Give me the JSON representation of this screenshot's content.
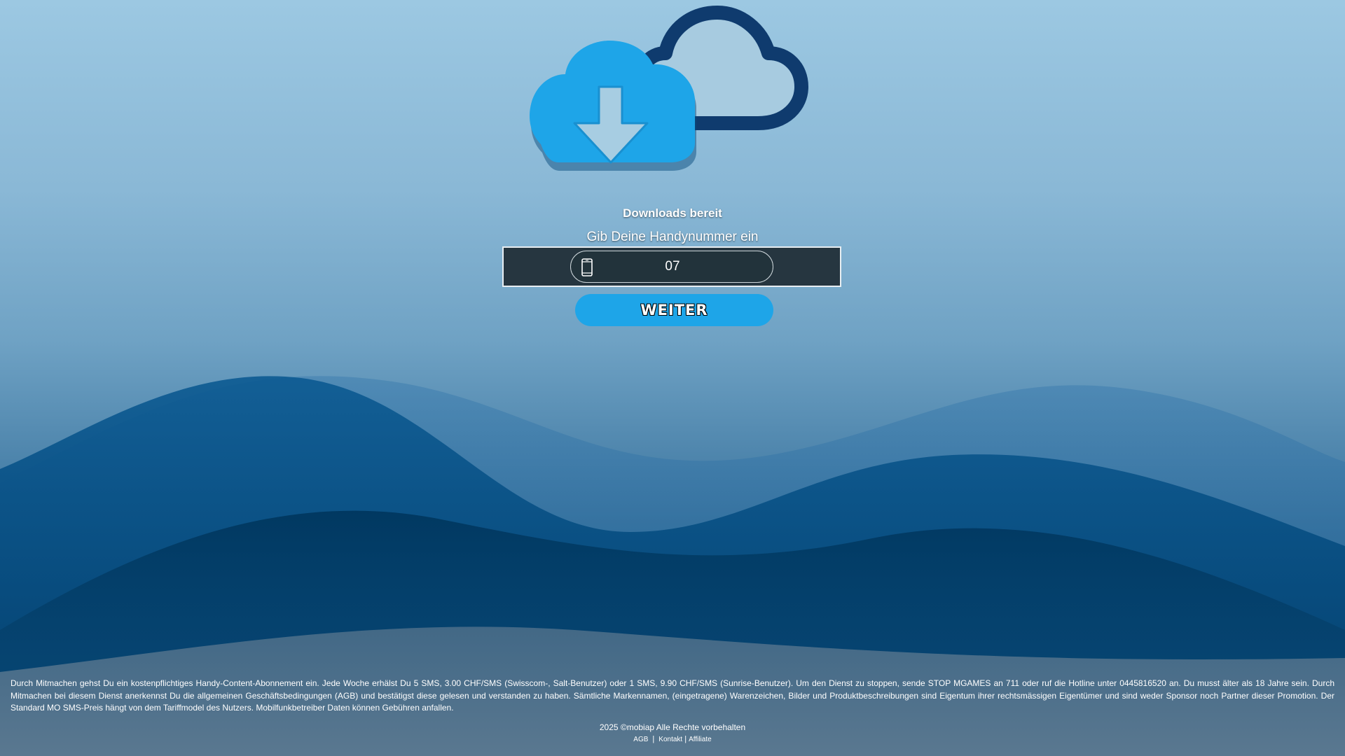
{
  "colors": {
    "accent": "#1ea5e8",
    "cloud_front": "#1ea5e8",
    "cloud_back_outline": "#0f3b6e",
    "input_bg": "#22333b",
    "wave_dark": "#003a66"
  },
  "hero": {
    "icon": "cloud-download-icon",
    "ready_text": "Downloads bereit",
    "prompt_text": "Gib Deine Handynummer ein"
  },
  "form": {
    "phone_icon": "mobile-phone-icon",
    "phone_value": "07",
    "submit_label": "WEITER"
  },
  "footer": {
    "disclaimer": "Durch Mitmachen gehst Du ein kostenpflichtiges Handy-Content-Abonnement ein. Jede Woche erhälst Du 5 SMS, 3.00 CHF/SMS (Swisscom-, Salt-Benutzer) oder 1 SMS, 9.90 CHF/SMS (Sunrise-Benutzer). Um den Dienst zu stoppen, sende STOP MGAMES an 711 oder ruf die Hotline unter 0445816520 an. Du musst älter als 18 Jahre sein. Durch Mitmachen bei diesem Dienst anerkennst Du die allgemeinen Geschäftsbedingungen (AGB) und bestätigst diese gelesen und verstanden zu haben. Sämtliche Markennamen, (eingetragene) Warenzeichen, Bilder und Produktbeschreibungen sind Eigentum ihrer rechtsmässigen Eigentümer und sind weder Sponsor noch Partner dieser Promotion. Der Standard MO SMS-Preis hängt von dem Tariffmodel des Nutzers. Mobilfunkbetreiber Daten können Gebühren anfallen.",
    "copyright": "2025 ©mobiap Alle Rechte vorbehalten",
    "links": {
      "agb": "AGB",
      "separator": "|",
      "kontakt": "Kontakt",
      "affiliate": "Affiliate"
    }
  }
}
